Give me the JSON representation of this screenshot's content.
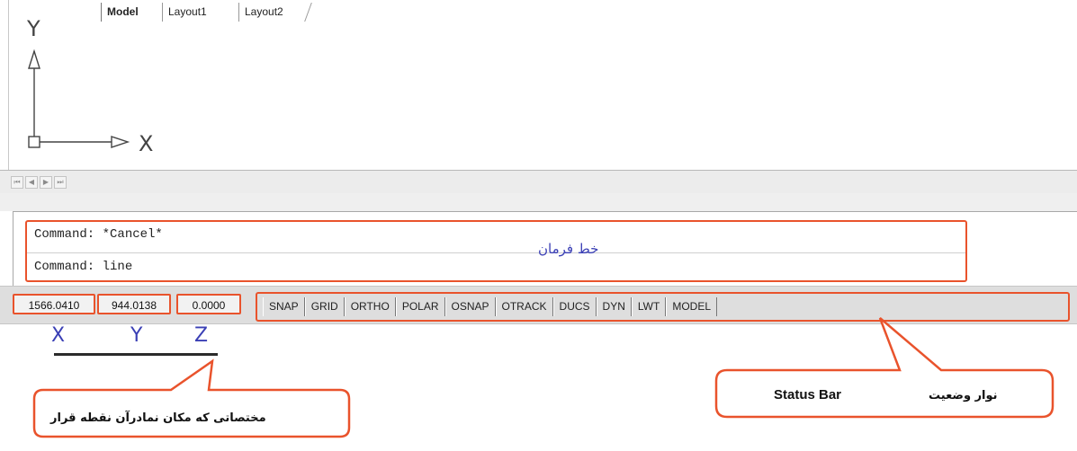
{
  "ucs_icon": {
    "y_label": "Y",
    "x_label": "X"
  },
  "tabs": {
    "nav_arrows": [
      "⏮",
      "◀",
      "▶",
      "⏭"
    ],
    "items": [
      {
        "label": "Model",
        "active": true
      },
      {
        "label": "Layout1",
        "active": false
      },
      {
        "label": "Layout2",
        "active": false
      }
    ]
  },
  "command_line": {
    "line1": "Command: *Cancel*",
    "line2": "Command: line",
    "annotation": "خط فرمان"
  },
  "status_bar": {
    "coordinates": {
      "x": "1566.0410",
      "y": "944.0138",
      "z": "0.0000"
    },
    "toggles": [
      "SNAP",
      "GRID",
      "ORTHO",
      "POLAR",
      "OSNAP",
      "OTRACK",
      "DUCS",
      "DYN",
      "LWT",
      "MODEL"
    ]
  },
  "axis_labels": {
    "x": "X",
    "y": "Y",
    "z": "Z"
  },
  "callouts": {
    "coordinates_fa": "مختصاتی که مکان نمادرآن نقطه قرار",
    "status_bar_fa": "نوار وضعیت",
    "status_bar_en": "Status Bar"
  },
  "colors": {
    "highlight": "#e9532c",
    "annotation_text": "#3a3fb5"
  }
}
